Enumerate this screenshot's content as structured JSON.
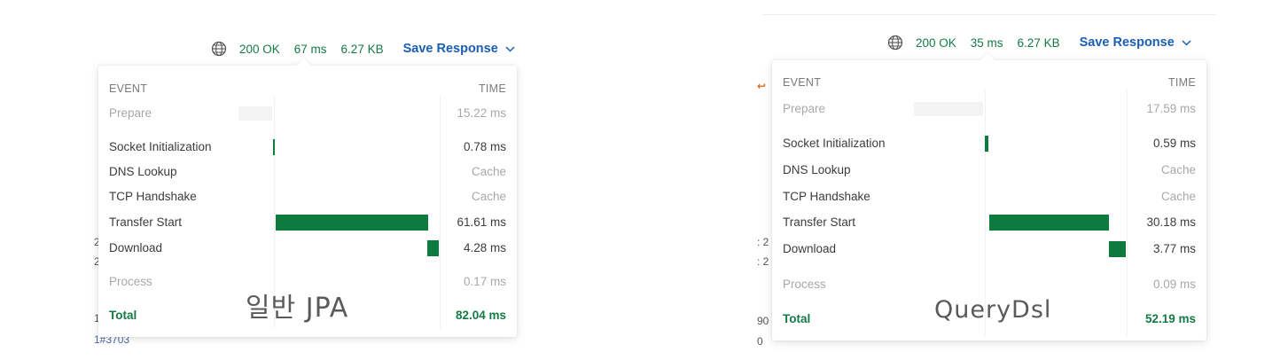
{
  "panels": [
    {
      "id": "left",
      "status": "200 OK",
      "time": "67 ms",
      "size": "6.27 KB",
      "save_label": "Save Response",
      "event_header": "EVENT",
      "time_header": "TIME",
      "rows": [
        {
          "label": "Prepare",
          "value": "15.22 ms",
          "style": "muted"
        },
        {
          "label": "Socket Initialization",
          "value": "0.78 ms",
          "style": "normal"
        },
        {
          "label": "DNS Lookup",
          "value": "Cache",
          "style": "cache"
        },
        {
          "label": "TCP Handshake",
          "value": "Cache",
          "style": "cache"
        },
        {
          "label": "Transfer Start",
          "value": "61.61 ms",
          "style": "normal"
        },
        {
          "label": "Download",
          "value": "4.28 ms",
          "style": "normal"
        },
        {
          "label": "Process",
          "value": "0.17 ms",
          "style": "muted"
        }
      ],
      "total_label": "Total",
      "total_value": "82.04 ms",
      "caption": "일반 JPA",
      "side_fragments": [
        "2",
        "2",
        "1",
        "1#3703"
      ]
    },
    {
      "id": "right",
      "status": "200 OK",
      "time": "35 ms",
      "size": "6.27 KB",
      "save_label": "Save Response",
      "event_header": "EVENT",
      "time_header": "TIME",
      "rows": [
        {
          "label": "Prepare",
          "value": "17.59 ms",
          "style": "muted"
        },
        {
          "label": "Socket Initialization",
          "value": "0.59 ms",
          "style": "normal"
        },
        {
          "label": "DNS Lookup",
          "value": "Cache",
          "style": "cache"
        },
        {
          "label": "TCP Handshake",
          "value": "Cache",
          "style": "cache"
        },
        {
          "label": "Transfer Start",
          "value": "30.18 ms",
          "style": "normal"
        },
        {
          "label": "Download",
          "value": "3.77 ms",
          "style": "normal"
        },
        {
          "label": "Process",
          "value": "0.09 ms",
          "style": "muted"
        }
      ],
      "total_label": "Total",
      "total_value": "52.19 ms",
      "caption": "QueryDsl",
      "side_fragments": [
        ": 2",
        ": 2",
        "90",
        "0"
      ]
    }
  ],
  "colors": {
    "bar": "#0d7a3e",
    "status_green": "#147a46",
    "link_blue": "#1a5fb4",
    "muted": "#a8a8a8"
  },
  "icons": {
    "network": "globe-icon",
    "dropdown": "chevron-down-icon",
    "wrap": "wrap-icon"
  }
}
